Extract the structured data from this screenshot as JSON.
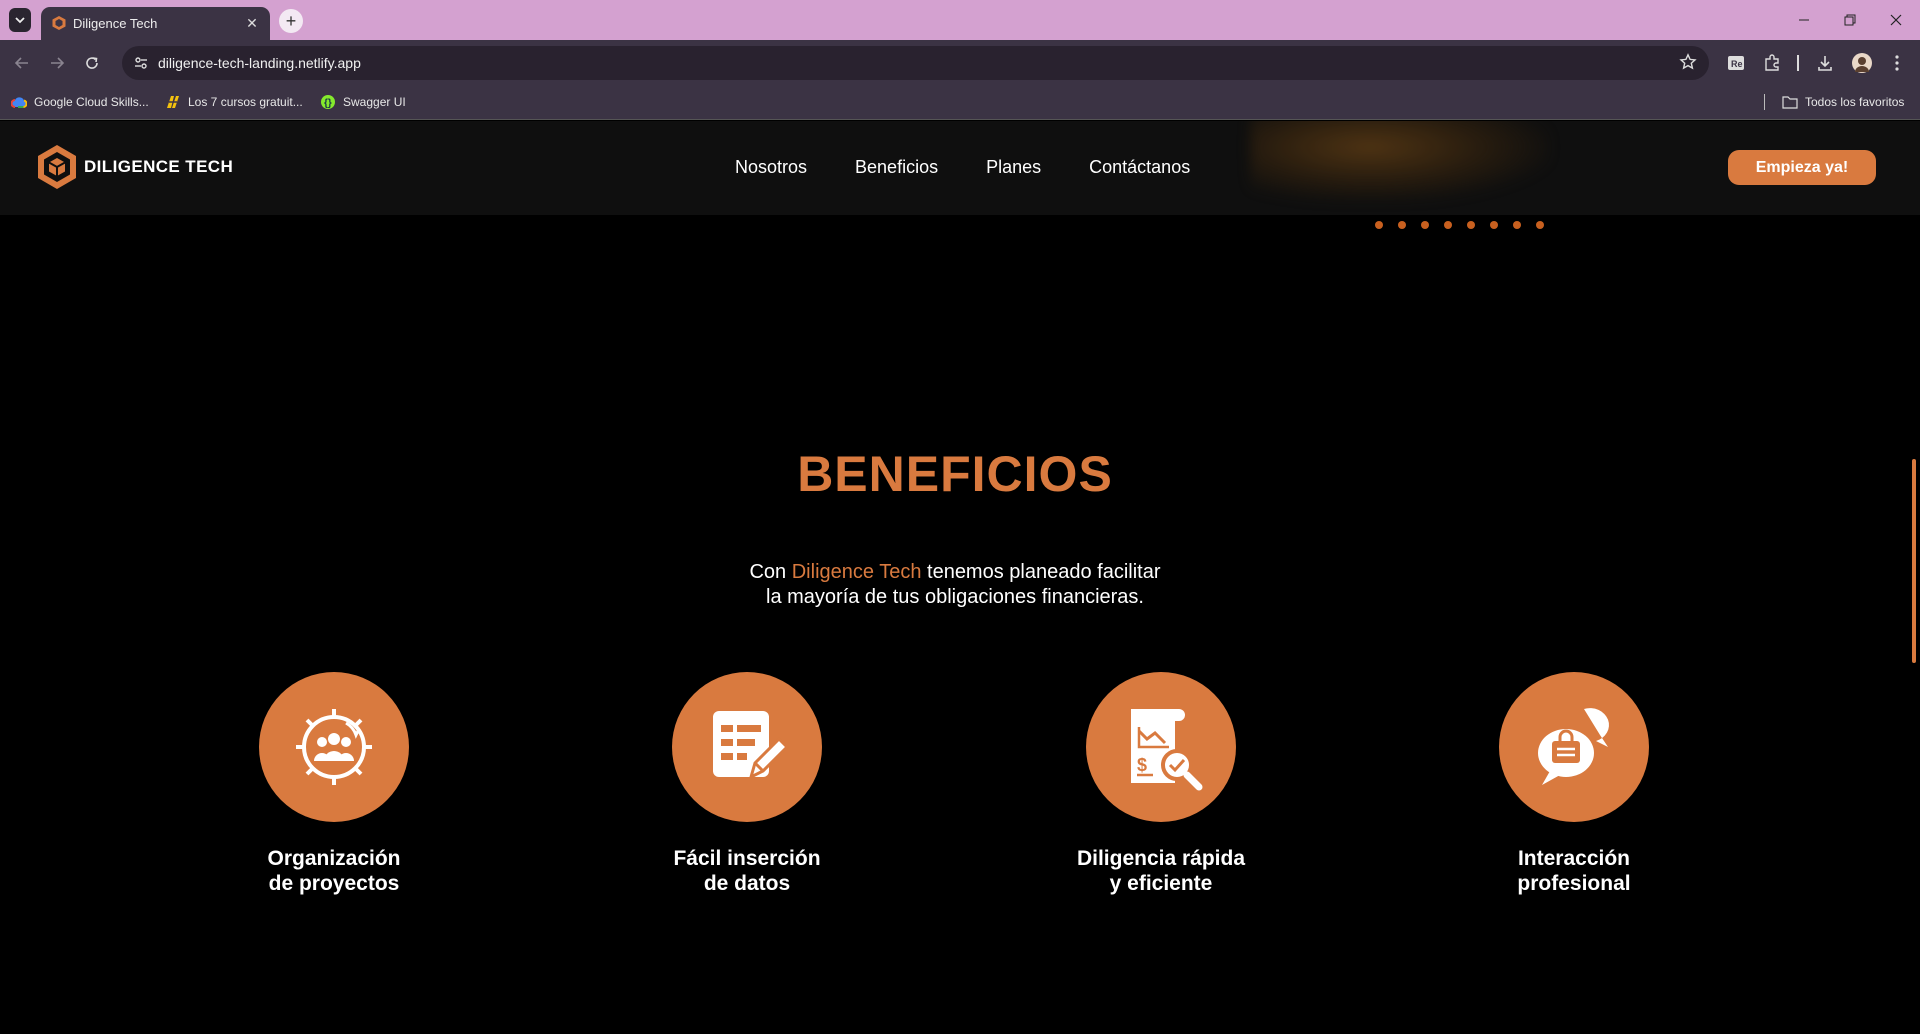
{
  "browser": {
    "tab_title": "Diligence Tech",
    "url": "diligence-tech-landing.netlify.app",
    "bookmarks": [
      {
        "label": "Google Cloud Skills...",
        "icon": "google-cloud-icon"
      },
      {
        "label": "Los 7 cursos gratuit...",
        "icon": "bookmark-favicon-icon"
      },
      {
        "label": "Swagger UI",
        "icon": "swagger-icon"
      }
    ],
    "all_bookmarks_label": "Todos los favoritos"
  },
  "site": {
    "logo_text": "DILIGENCE TECH",
    "nav": [
      "Nosotros",
      "Beneficios",
      "Planes",
      "Contáctanos"
    ],
    "cta_label": "Empieza ya!"
  },
  "benefits": {
    "title": "BENEFICIOS",
    "subtitle_prefix": "Con ",
    "subtitle_brand": "Diligence Tech",
    "subtitle_line1_suffix": " tenemos planeado facilitar",
    "subtitle_line2": "la mayoría de tus obligaciones financieras.",
    "items": [
      {
        "line1": "Organización",
        "line2": "de proyectos",
        "icon": "team-gear-icon"
      },
      {
        "line1": "Fácil inserción",
        "line2": "de datos",
        "icon": "form-edit-icon"
      },
      {
        "line1": "Diligencia rápida",
        "line2": "y eficiente",
        "icon": "finance-report-icon"
      },
      {
        "line1": "Interacción",
        "line2": "profesional",
        "icon": "chat-bubbles-icon"
      }
    ]
  },
  "colors": {
    "accent": "#d97a3f",
    "chrome_tab": "#d4a1d0",
    "chrome_bar": "#3b3344"
  }
}
